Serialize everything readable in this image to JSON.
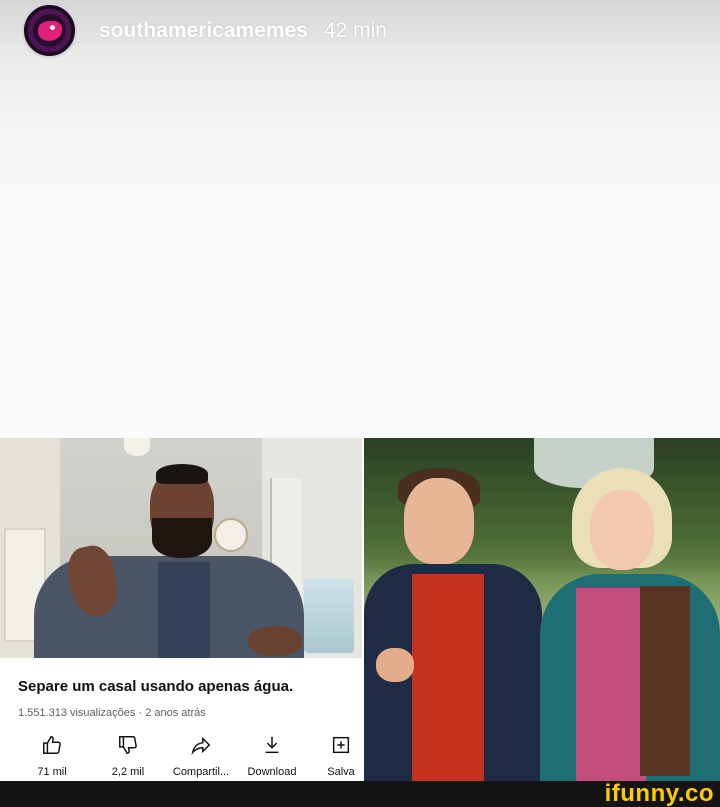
{
  "story": {
    "username": "southamericamemes",
    "time": "42 min"
  },
  "video": {
    "title": "Separe um casal usando apenas água.",
    "meta": "1.551.313 visualizações · 2 anos atrás",
    "actions": [
      {
        "icon": "thumbs-up-icon",
        "label": "71 mil"
      },
      {
        "icon": "thumbs-down-icon",
        "label": "2,2 mil"
      },
      {
        "icon": "share-icon",
        "label": "Compartil..."
      },
      {
        "icon": "download-icon",
        "label": "Download"
      },
      {
        "icon": "save-icon",
        "label": "Salva"
      }
    ]
  },
  "watermark": "ifunny.co",
  "colors": {
    "watermark": "#ffcc00",
    "bottom_bar": "#141414"
  }
}
